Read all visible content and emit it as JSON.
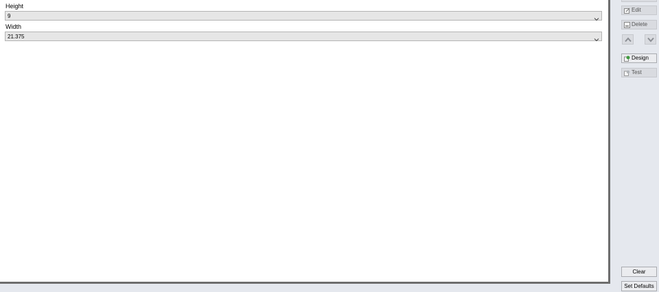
{
  "form": {
    "fields": [
      {
        "label": "Height",
        "value": "9"
      },
      {
        "label": "Width",
        "value": "21.375"
      }
    ]
  },
  "side_panel": {
    "edit_label": "Edit",
    "delete_label": "Delete",
    "design_label": "Design",
    "test_label": "Test",
    "clear_label": "Clear",
    "set_defaults_label": "Set Defaults"
  },
  "icons": {
    "edit": "edit-icon",
    "delete": "delete-icon",
    "move_up": "arrow-up-icon",
    "move_down": "arrow-down-icon",
    "design": "design-icon",
    "test": "test-icon",
    "dropdown": "chevron-down-icon"
  },
  "colors": {
    "panel_background": "#e5e8ee",
    "content_background": "#ffffff",
    "combo_background": "#e6e6e6",
    "disabled_text": "#555555"
  }
}
